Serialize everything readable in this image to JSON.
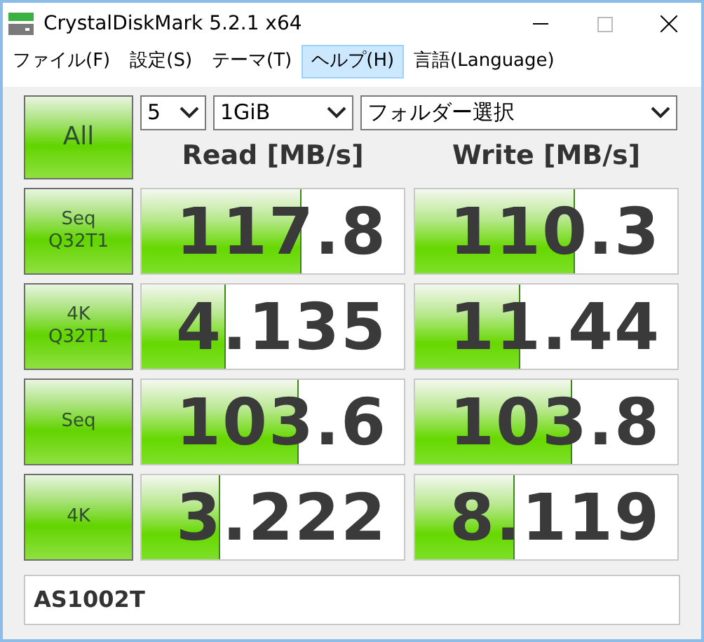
{
  "window": {
    "title": "CrystalDiskMark 5.2.1 x64"
  },
  "menu": [
    {
      "label": "ファイル(F)",
      "selected": false
    },
    {
      "label": "設定(S)",
      "selected": false
    },
    {
      "label": "テーマ(T)",
      "selected": false
    },
    {
      "label": "ヘルプ(H)",
      "selected": true
    },
    {
      "label": "言語(Language)",
      "selected": false
    }
  ],
  "all_button": "All",
  "count_select": "5",
  "size_select": "1GiB",
  "folder_select": "フォルダー選択",
  "headers": [
    "Read [MB/s]",
    "Write [MB/s]"
  ],
  "rows": [
    {
      "label": [
        "Seq",
        "Q32T1"
      ],
      "read": {
        "value": "117.8",
        "level": 0.61
      },
      "write": {
        "value": "110.3",
        "level": 0.61
      }
    },
    {
      "label": [
        "4K",
        "Q32T1"
      ],
      "read": {
        "value": "4.135",
        "level": 0.32
      },
      "write": {
        "value": "11.44",
        "level": 0.4
      }
    },
    {
      "label": [
        "Seq"
      ],
      "read": {
        "value": "103.6",
        "level": 0.6
      },
      "write": {
        "value": "103.8",
        "level": 0.6
      }
    },
    {
      "label": [
        "4K"
      ],
      "read": {
        "value": "3.222",
        "level": 0.3
      },
      "write": {
        "value": "8.119",
        "level": 0.38
      }
    }
  ],
  "comment": "AS1002T"
}
